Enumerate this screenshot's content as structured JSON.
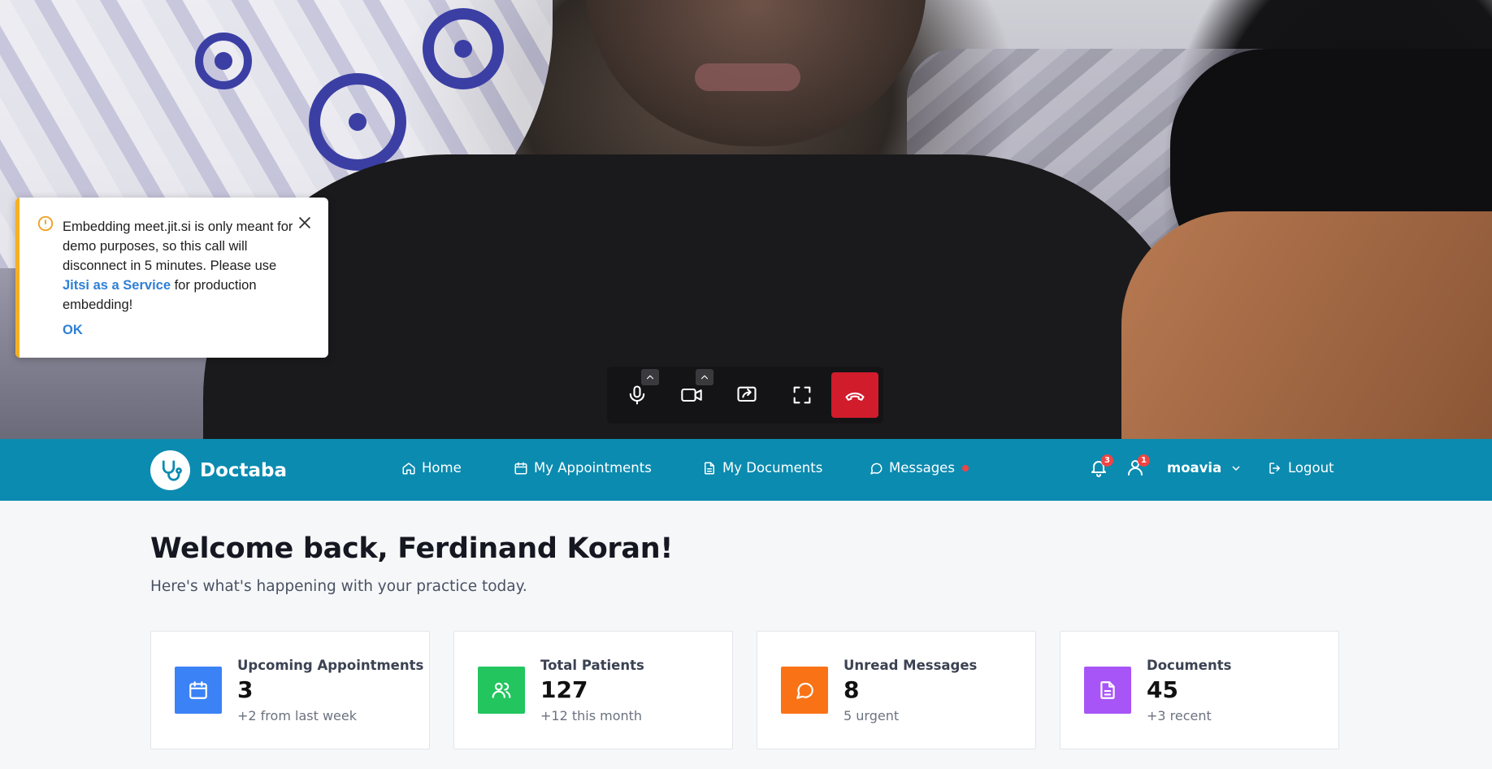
{
  "notification": {
    "text_before": "Embedding meet.jit.si is only meant for demo purposes, so this call will disconnect in 5 minutes. Please use ",
    "link_text": "Jitsi as a Service",
    "text_after": " for production embedding!",
    "ok_label": "OK"
  },
  "call_toolbar": {
    "buttons": [
      "microphone-icon",
      "camera-icon",
      "share-screen-icon",
      "fullscreen-icon",
      "hangup-icon"
    ],
    "hangup_color": "#d11c2c"
  },
  "navbar": {
    "brand": "Doctaba",
    "color": "#0b8bb0",
    "items": [
      {
        "label": "Home",
        "icon": "home-icon"
      },
      {
        "label": "My Appointments",
        "icon": "calendar-icon"
      },
      {
        "label": "My Documents",
        "icon": "document-icon"
      },
      {
        "label": "Messages",
        "icon": "chat-icon"
      }
    ],
    "notifications_count": "3",
    "user_requests_count": "1",
    "username": "moavia",
    "logout_label": "Logout"
  },
  "dashboard": {
    "welcome": "Welcome back, Ferdinand Koran!",
    "subtitle": "Here's what's happening with your practice today.",
    "stats": [
      {
        "label": "Upcoming Appointments",
        "value": "3",
        "sub": "+2 from last week",
        "color": "#3b82f6",
        "icon": "calendar-icon"
      },
      {
        "label": "Total Patients",
        "value": "127",
        "sub": "+12 this month",
        "color": "#22c55e",
        "icon": "users-icon"
      },
      {
        "label": "Unread Messages",
        "value": "8",
        "sub": "5 urgent",
        "color": "#f97316",
        "icon": "chat-icon"
      },
      {
        "label": "Documents",
        "value": "45",
        "sub": "+3 recent",
        "color": "#a855f7",
        "icon": "document-icon"
      }
    ]
  }
}
